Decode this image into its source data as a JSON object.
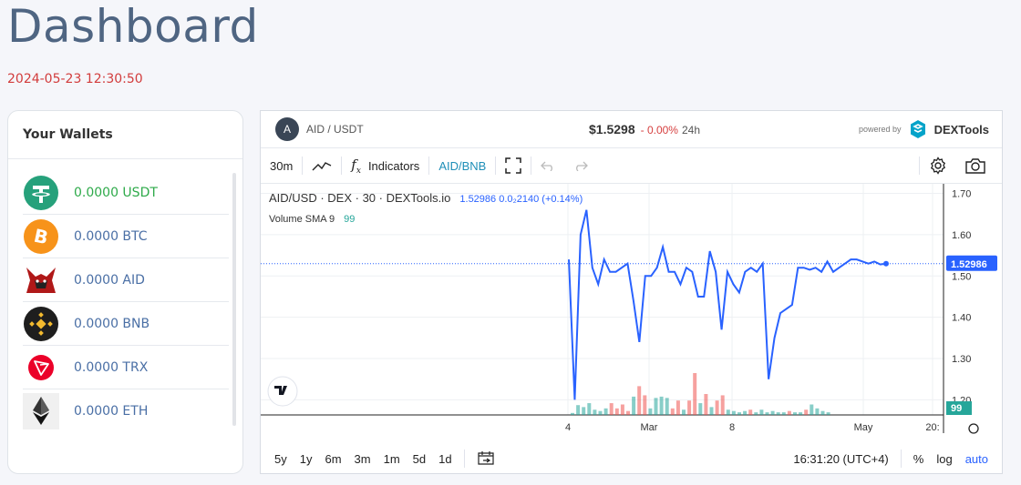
{
  "page": {
    "title": "Dashboard",
    "datetime": "2024-05-23 12:30:50"
  },
  "wallet": {
    "header": "Your Wallets",
    "items": [
      {
        "label": "0.0000 USDT",
        "icon": "usdt-icon",
        "color": "#26a17b"
      },
      {
        "label": "0.0000 BTC",
        "icon": "btc-icon",
        "color": "#f7931a"
      },
      {
        "label": "0.0000 AID",
        "icon": "aid-icon",
        "color": "#b01818"
      },
      {
        "label": "0.0000 BNB",
        "icon": "bnb-icon",
        "color": "#f3ba2f"
      },
      {
        "label": "0.0000 TRX",
        "icon": "trx-icon",
        "color": "#eb0029"
      },
      {
        "label": "0.0000 ETH",
        "icon": "eth-icon",
        "color": "#343434"
      }
    ]
  },
  "chart_widget": {
    "avatar_letter": "A",
    "pair": "AID / USDT",
    "price": "$1.5298",
    "change": "- 0.00%",
    "period": "24h",
    "powered_by": "powered by",
    "brand": "DEXTools",
    "toolbar": {
      "interval": "30m",
      "indicators": "Indicators",
      "compare": "AID/BNB"
    },
    "legend": {
      "title": "AID/USD · DEX · 30 · DEXTools.io",
      "values": "1.52986  0.0₂2140 (+0.14%)",
      "volume_label": "Volume SMA 9",
      "volume_value": "99"
    },
    "bottom": {
      "ranges": [
        "5y",
        "1y",
        "6m",
        "3m",
        "1m",
        "5d",
        "1d"
      ],
      "time": "16:31:20 (UTC+4)",
      "percent": "%",
      "log": "log",
      "auto": "auto"
    },
    "colors": {
      "line": "#2962ff",
      "up_volume": "#26a69a",
      "down_volume": "#ef5350",
      "last_price_bg": "#2962ff",
      "volume_badge_bg": "#26a69a"
    }
  },
  "chart_data": {
    "type": "line",
    "series": [
      {
        "values": [
          1.54,
          1.2,
          1.6,
          1.66,
          1.52,
          1.48,
          1.54,
          1.51,
          1.51,
          1.52,
          1.53,
          1.44,
          1.34,
          1.5,
          1.5,
          1.52,
          1.57,
          1.51,
          1.51,
          1.48,
          1.52,
          1.51,
          1.45,
          1.45,
          1.56,
          1.51,
          1.37,
          1.51,
          1.48,
          1.46,
          1.51,
          1.52,
          1.51,
          1.53,
          1.25,
          1.35,
          1.41,
          1.42,
          1.43,
          1.52,
          1.52,
          1.515,
          1.52,
          1.51,
          1.535,
          1.51,
          1.52,
          1.53,
          1.54,
          1.54,
          1.535,
          1.53,
          1.535,
          1.528,
          1.5298
        ]
      }
    ],
    "volume": [
      {
        "v": 3,
        "up": true
      },
      {
        "v": 15,
        "up": true
      },
      {
        "v": 12,
        "up": true
      },
      {
        "v": 18,
        "up": true
      },
      {
        "v": 8,
        "up": true
      },
      {
        "v": 6,
        "up": true
      },
      {
        "v": 10,
        "up": true
      },
      {
        "v": 18,
        "up": false
      },
      {
        "v": 10,
        "up": false
      },
      {
        "v": 16,
        "up": false
      },
      {
        "v": 6,
        "up": false
      },
      {
        "v": 28,
        "up": true
      },
      {
        "v": 44,
        "up": false
      },
      {
        "v": 30,
        "up": false
      },
      {
        "v": 10,
        "up": true
      },
      {
        "v": 26,
        "up": true
      },
      {
        "v": 28,
        "up": true
      },
      {
        "v": 26,
        "up": true
      },
      {
        "v": 10,
        "up": false
      },
      {
        "v": 22,
        "up": false
      },
      {
        "v": 8,
        "up": true
      },
      {
        "v": 22,
        "up": false
      },
      {
        "v": 64,
        "up": false
      },
      {
        "v": 18,
        "up": true
      },
      {
        "v": 32,
        "up": false
      },
      {
        "v": 12,
        "up": true
      },
      {
        "v": 22,
        "up": false
      },
      {
        "v": 30,
        "up": false
      },
      {
        "v": 8,
        "up": true
      },
      {
        "v": 6,
        "up": true
      },
      {
        "v": 4,
        "up": true
      },
      {
        "v": 6,
        "up": true
      },
      {
        "v": 8,
        "up": false
      },
      {
        "v": 4,
        "up": true
      },
      {
        "v": 8,
        "up": true
      },
      {
        "v": 4,
        "up": true
      },
      {
        "v": 6,
        "up": true
      },
      {
        "v": 4,
        "up": true
      },
      {
        "v": 4,
        "up": true
      },
      {
        "v": 6,
        "up": false
      },
      {
        "v": 4,
        "up": true
      },
      {
        "v": 4,
        "up": true
      },
      {
        "v": 8,
        "up": false
      },
      {
        "v": 16,
        "up": true
      },
      {
        "v": 10,
        "up": true
      },
      {
        "v": 6,
        "up": true
      },
      {
        "v": 4,
        "up": true
      }
    ],
    "x_ticks": [
      "4",
      "Mar",
      "8",
      "May",
      "20:"
    ],
    "y_ticks": [
      "1.70",
      "1.60",
      "1.50",
      "1.40",
      "1.30",
      "1.20"
    ],
    "ylim": [
      1.17,
      1.71
    ],
    "last_price": "1.52986",
    "volume_badge": "99",
    "grid": true
  }
}
